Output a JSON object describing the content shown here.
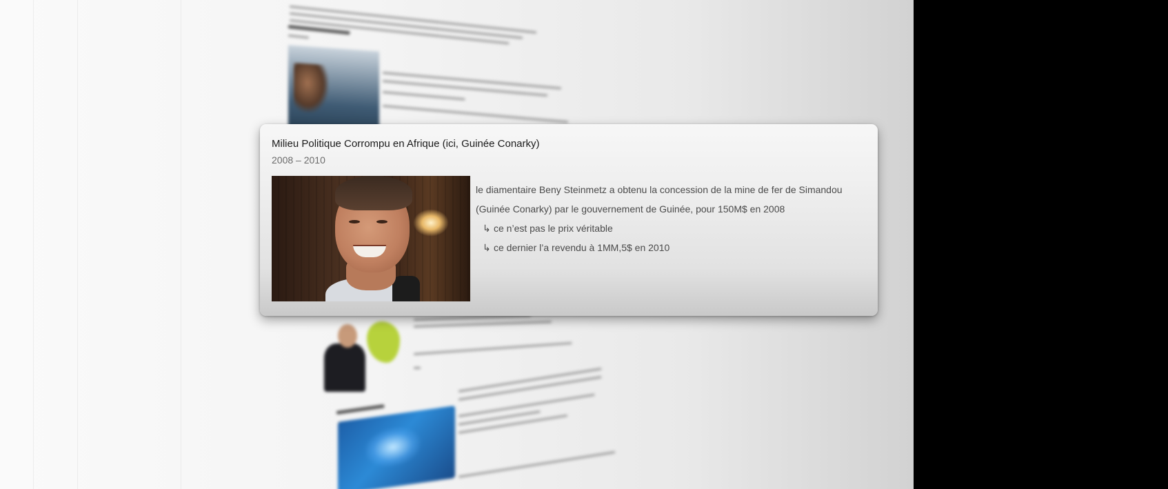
{
  "card": {
    "title": "Milieu Politique Corrompu en Afrique (ici, Guinée Conarky)",
    "period": "2008 – 2010",
    "photo_icon": "portrait-photo",
    "description_line1": "le diamentaire Beny Steinmetz a obtenu la concession de la mine de fer de Simandou",
    "description_line2": "(Guinée Conarky) par le gouvernement de Guinée, pour 150M$ en 2008",
    "bullets": [
      {
        "arrow": "↳",
        "text": "ce n’est pas le prix véritable"
      },
      {
        "arrow": "↳",
        "text": "ce dernier l’a revendu à 1MM,5$ en 2010"
      }
    ]
  }
}
